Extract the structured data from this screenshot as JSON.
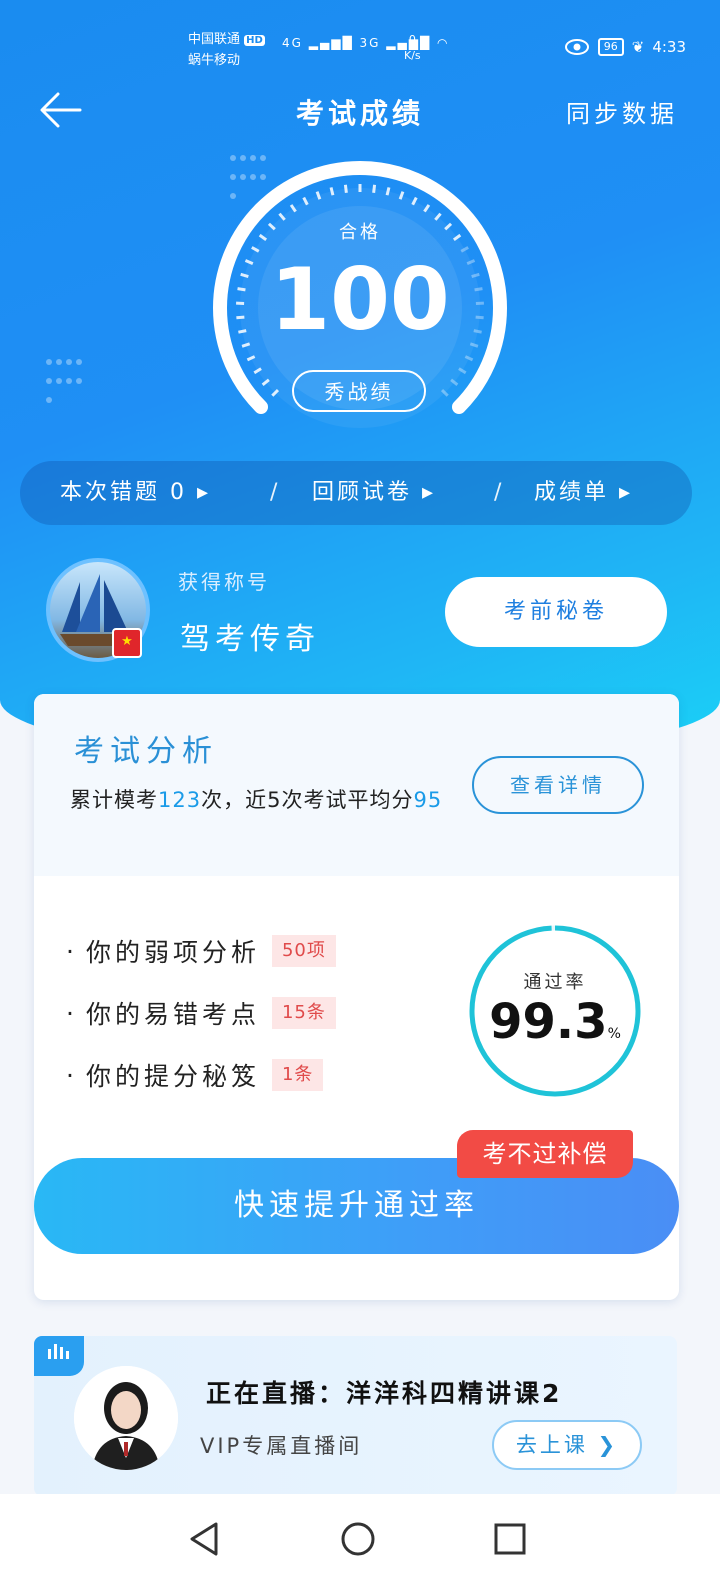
{
  "status_bar": {
    "carrier1": "中国联通",
    "carrier2": "蜗牛移动",
    "hd": "HD",
    "net1": "4G",
    "net2": "3G",
    "speed_value": "0",
    "speed_unit": "K/s",
    "battery": "96",
    "time": "4:33"
  },
  "header": {
    "title": "考试成绩",
    "sync_label": "同步数据"
  },
  "score": {
    "status": "合格",
    "value": "100",
    "show_button": "秀战绩",
    "gauge_fraction": 0.72
  },
  "quick_nav": {
    "wrong": "本次错题 0 ▸",
    "review": "回顾试卷 ▸",
    "report": "成绩单 ▸",
    "separator": "/"
  },
  "title_badge": {
    "label": "获得称号",
    "value": "驾考传奇",
    "pre_exam_button": "考前秘卷"
  },
  "analysis": {
    "title": "考试分析",
    "summary_prefix": "累计模考",
    "count": "123",
    "summary_mid": "次，近5次考试平均分",
    "avg": "95",
    "detail_button": "查看详情",
    "items": [
      {
        "label": "你的弱项分析",
        "badge": "50项"
      },
      {
        "label": "你的易错考点",
        "badge": "15条"
      },
      {
        "label": "你的提分秘笈",
        "badge": "1条"
      }
    ],
    "pass_rate_label": "通过率",
    "pass_rate_value": "99.3",
    "pass_rate_unit": "%",
    "pass_rate_fraction": 0.993,
    "boost_button": "快速提升通过率",
    "compensation_tag": "考不过补偿"
  },
  "live": {
    "title": "正在直播：洋洋科四精讲课2",
    "subtitle": "VIP专属直播间",
    "go_button": "去上课"
  },
  "colors": {
    "brand_blue": "#1a8cf0",
    "accent_cyan": "#1fc3e8",
    "alert_red": "#f24b45"
  }
}
